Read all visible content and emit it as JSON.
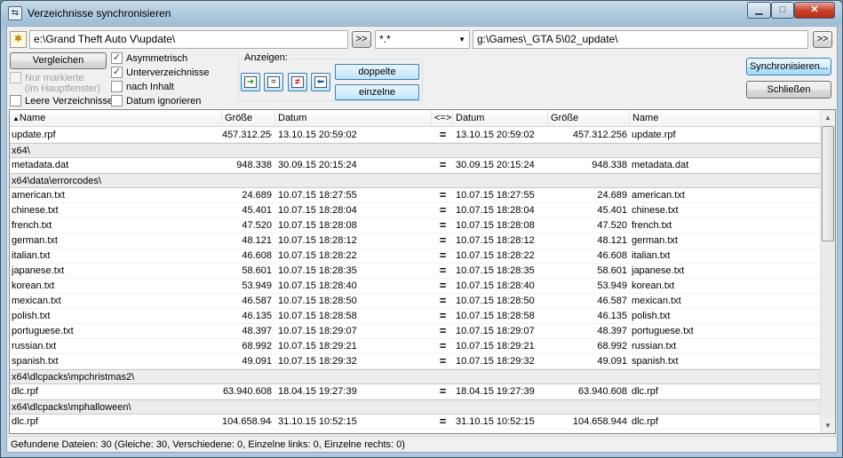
{
  "window": {
    "title": "Verzeichnisse synchronisieren",
    "minimize_glyph": "▁",
    "maximize_glyph": "□",
    "close_glyph": "✕"
  },
  "toolbar": {
    "left_path": "e:\\Grand Theft Auto V\\update\\",
    "browse_left": ">>",
    "filter": "*.*",
    "right_path": "g:\\Games\\_GTA 5\\02_update\\",
    "browse_right": ">>"
  },
  "options": {
    "compare": "Vergleichen",
    "only_marked": "Nur markierte",
    "main_window": "(im Hauptfenster)",
    "empty_dirs": "Leere Verzeichnisse",
    "asymmetric": "Asymmetrisch",
    "subdirs": "Unterverzeichnisse",
    "by_content": "nach Inhalt",
    "ignore_date": "Datum ignorieren",
    "show_label": "Anzeigen:",
    "duplicates": "doppelte",
    "singles": "einzelne",
    "synchronize": "Synchronisieren...",
    "close": "Schließen"
  },
  "columns": {
    "name_left": "Name",
    "size_left": "Größe",
    "date_left": "Datum",
    "compare": "<=>",
    "date_right": "Datum",
    "size_right": "Größe",
    "name_right": "Name"
  },
  "rows": [
    {
      "type": "file",
      "lname": "update.rpf",
      "lsize": "457.312.256",
      "ldate": "13.10.15 20:59:02",
      "cmp": "=",
      "rdate": "13.10.15 20:59:02",
      "rsize": "457.312.256",
      "rname": "update.rpf"
    },
    {
      "type": "folder",
      "label": "x64\\"
    },
    {
      "type": "file",
      "lname": "metadata.dat",
      "lsize": "948.338",
      "ldate": "30.09.15 20:15:24",
      "cmp": "=",
      "rdate": "30.09.15 20:15:24",
      "rsize": "948.338",
      "rname": "metadata.dat"
    },
    {
      "type": "folder",
      "label": "x64\\data\\errorcodes\\"
    },
    {
      "type": "file",
      "lname": "american.txt",
      "lsize": "24.689",
      "ldate": "10.07.15 18:27:55",
      "cmp": "=",
      "rdate": "10.07.15 18:27:55",
      "rsize": "24.689",
      "rname": "american.txt"
    },
    {
      "type": "file",
      "lname": "chinese.txt",
      "lsize": "45.401",
      "ldate": "10.07.15 18:28:04",
      "cmp": "=",
      "rdate": "10.07.15 18:28:04",
      "rsize": "45.401",
      "rname": "chinese.txt"
    },
    {
      "type": "file",
      "lname": "french.txt",
      "lsize": "47.520",
      "ldate": "10.07.15 18:28:08",
      "cmp": "=",
      "rdate": "10.07.15 18:28:08",
      "rsize": "47.520",
      "rname": "french.txt"
    },
    {
      "type": "file",
      "lname": "german.txt",
      "lsize": "48.121",
      "ldate": "10.07.15 18:28:12",
      "cmp": "=",
      "rdate": "10.07.15 18:28:12",
      "rsize": "48.121",
      "rname": "german.txt"
    },
    {
      "type": "file",
      "lname": "italian.txt",
      "lsize": "46.608",
      "ldate": "10.07.15 18:28:22",
      "cmp": "=",
      "rdate": "10.07.15 18:28:22",
      "rsize": "46.608",
      "rname": "italian.txt"
    },
    {
      "type": "file",
      "lname": "japanese.txt",
      "lsize": "58.601",
      "ldate": "10.07.15 18:28:35",
      "cmp": "=",
      "rdate": "10.07.15 18:28:35",
      "rsize": "58.601",
      "rname": "japanese.txt"
    },
    {
      "type": "file",
      "lname": "korean.txt",
      "lsize": "53.949",
      "ldate": "10.07.15 18:28:40",
      "cmp": "=",
      "rdate": "10.07.15 18:28:40",
      "rsize": "53.949",
      "rname": "korean.txt"
    },
    {
      "type": "file",
      "lname": "mexican.txt",
      "lsize": "46.587",
      "ldate": "10.07.15 18:28:50",
      "cmp": "=",
      "rdate": "10.07.15 18:28:50",
      "rsize": "46.587",
      "rname": "mexican.txt"
    },
    {
      "type": "file",
      "lname": "polish.txt",
      "lsize": "46.135",
      "ldate": "10.07.15 18:28:58",
      "cmp": "=",
      "rdate": "10.07.15 18:28:58",
      "rsize": "46.135",
      "rname": "polish.txt"
    },
    {
      "type": "file",
      "lname": "portuguese.txt",
      "lsize": "48.397",
      "ldate": "10.07.15 18:29:07",
      "cmp": "=",
      "rdate": "10.07.15 18:29:07",
      "rsize": "48.397",
      "rname": "portuguese.txt"
    },
    {
      "type": "file",
      "lname": "russian.txt",
      "lsize": "68.992",
      "ldate": "10.07.15 18:29:21",
      "cmp": "=",
      "rdate": "10.07.15 18:29:21",
      "rsize": "68.992",
      "rname": "russian.txt"
    },
    {
      "type": "file",
      "lname": "spanish.txt",
      "lsize": "49.091",
      "ldate": "10.07.15 18:29:32",
      "cmp": "=",
      "rdate": "10.07.15 18:29:32",
      "rsize": "49.091",
      "rname": "spanish.txt"
    },
    {
      "type": "folder",
      "label": "x64\\dlcpacks\\mpchristmas2\\"
    },
    {
      "type": "file",
      "lname": "dlc.rpf",
      "lsize": "63.940.608",
      "ldate": "18.04.15 19:27:39",
      "cmp": "=",
      "rdate": "18.04.15 19:27:39",
      "rsize": "63.940.608",
      "rname": "dlc.rpf"
    },
    {
      "type": "folder",
      "label": "x64\\dlcpacks\\mphalloween\\"
    },
    {
      "type": "file",
      "lname": "dlc.rpf",
      "lsize": "104.658.944",
      "ldate": "31.10.15 10:52:15",
      "cmp": "=",
      "rdate": "31.10.15 10:52:15",
      "rsize": "104.658.944",
      "rname": "dlc.rpf"
    }
  ],
  "status": {
    "text": "Gefundene Dateien: 30  (Gleiche: 30, Verschiedene: 0, Einzelne links: 0, Einzelne rechts: 0)"
  }
}
